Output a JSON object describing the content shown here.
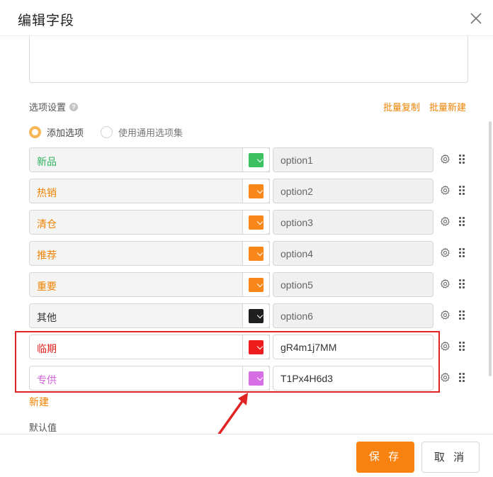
{
  "dialog": {
    "title": "编辑字段"
  },
  "options_section": {
    "label": "选项设置",
    "help": "?",
    "batch_copy": "批量复制",
    "batch_new": "批量新建"
  },
  "radio": {
    "add_option": "添加选项",
    "use_common": "使用通用选项集"
  },
  "options": [
    {
      "name": "新品",
      "value": "option1",
      "name_color": "#2fb55e",
      "swatch": "#3cc160"
    },
    {
      "name": "热销",
      "value": "option2",
      "name_color": "#f08200",
      "swatch": "#f8871a"
    },
    {
      "name": "清仓",
      "value": "option3",
      "name_color": "#f08200",
      "swatch": "#f8871a"
    },
    {
      "name": "推荐",
      "value": "option4",
      "name_color": "#f08200",
      "swatch": "#f8871a"
    },
    {
      "name": "重要",
      "value": "option5",
      "name_color": "#f08200",
      "swatch": "#f8871a"
    },
    {
      "name": "其他",
      "value": "option6",
      "name_color": "#333333",
      "swatch": "#1f1f1f"
    },
    {
      "name": "临期",
      "value": "gR4m1j7MM",
      "name_color": "#e02020",
      "swatch": "#ee1c1c"
    },
    {
      "name": "专供",
      "value": "T1Px4H6d3",
      "name_color": "#d063d8",
      "swatch": "#d86ee6"
    }
  ],
  "new_link": "新建",
  "default_label": "默认值",
  "footer": {
    "save": "保 存",
    "cancel": "取 消"
  },
  "colors": {
    "accent": "#f7820f",
    "annotation": "#e02424"
  }
}
